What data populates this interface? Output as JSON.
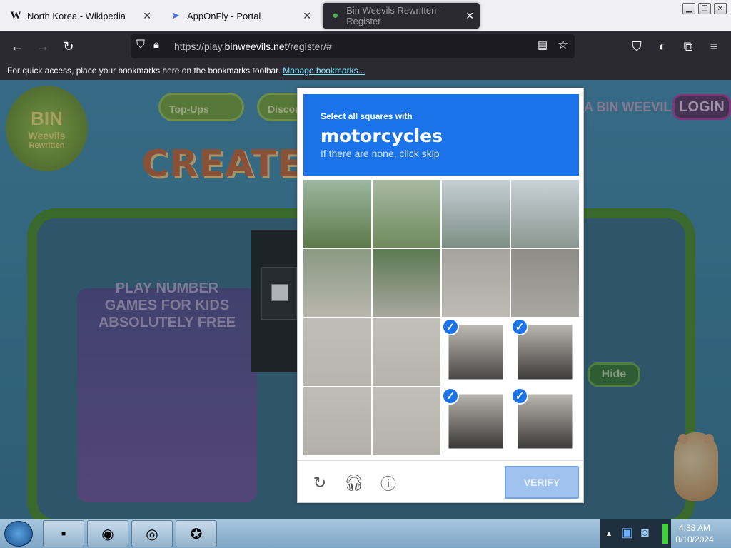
{
  "tabs": [
    {
      "title": "North Korea - Wikipedia",
      "favicon": "W"
    },
    {
      "title": "AppOnFly - Portal",
      "favicon": "arrow-icon"
    },
    {
      "title": "Bin Weevils Rewritten - Register",
      "favicon": "weevil-icon"
    }
  ],
  "url": {
    "prefix": "https://play.",
    "domain": "binweevils.net",
    "path": "/register/#"
  },
  "bookmarks": {
    "text": "For quick access, place your bookmarks here on the bookmarks toolbar.",
    "link": "Manage bookmarks..."
  },
  "site": {
    "logo_line1": "BIN",
    "logo_line2": "Weevils",
    "logo_line3": "Rewritten",
    "nav1": "Top-Ups",
    "nav2": "Discor",
    "headline": "CREATE Y",
    "weevil_question": "A BIN WEEVIL?",
    "login": "LOGIN",
    "ad_lines": [
      "PLAY NUMBER",
      "GAMES FOR KIDS",
      "ABSOLUTELY FREE"
    ],
    "hide": "Hide"
  },
  "captcha": {
    "line1": "Select all squares with",
    "target": "motorcycles",
    "skip_hint": "If there are none, click skip",
    "verify": "VERIFY",
    "selected_tiles": [
      10,
      11,
      14,
      15
    ]
  },
  "taskbar": {
    "time": "4:38 AM",
    "date": "8/10/2024"
  },
  "colors": {
    "accent": "#1a73e8",
    "browser_dark": "#2b2a33"
  }
}
